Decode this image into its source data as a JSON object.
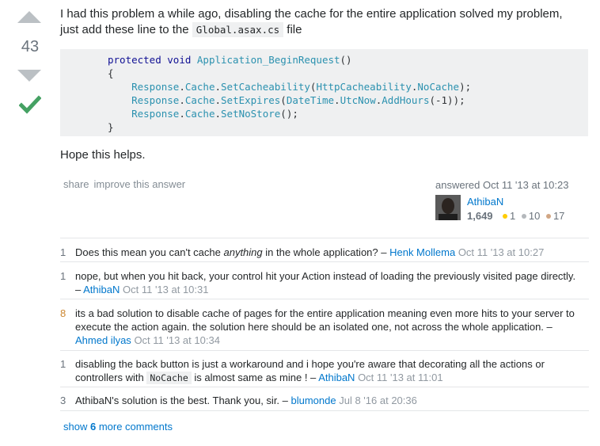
{
  "vote": {
    "count": "43"
  },
  "answer": {
    "text_before_code": "I had this problem a while ago, disabling the cache for the entire application solved my problem, just add these line to the ",
    "inline_code": "Global.asax.cs",
    "text_after_code": " file",
    "code": {
      "l1_kw": "protected",
      "l1_kw2": "void",
      "l1_fn": "Application_BeginRequest",
      "l1_rest": "()",
      "l2": "{",
      "l3_prefix": "    ",
      "l3_a": "Response",
      "l3_b": ".",
      "l3_c": "Cache",
      "l3_d": ".",
      "l3_e": "SetCacheability",
      "l3_f": "(",
      "l3_g": "HttpCacheability",
      "l3_h": ".",
      "l3_i": "NoCache",
      "l3_j": ");",
      "l4_a": "Response",
      "l4_c": "Cache",
      "l4_e": "SetExpires",
      "l4_g": "DateTime",
      "l4_i": "UtcNow",
      "l4_k": "AddHours",
      "l4_rest": "(-1));",
      "l5_a": "Response",
      "l5_c": "Cache",
      "l5_e": "SetNoStore",
      "l5_rest": "();",
      "l6": "}"
    },
    "closing": "Hope this helps."
  },
  "post_menu": {
    "share": "share",
    "improve": "improve this answer"
  },
  "user": {
    "action": "answered Oct 11 '13 at 10:23",
    "name": "AthibaN",
    "reputation": "1,649",
    "gold": "1",
    "silver": "10",
    "bronze": "17"
  },
  "comments": [
    {
      "score": "1",
      "pre": "Does this mean you can't cache ",
      "em": "anything",
      "post": " in the whole application? – ",
      "user": "Henk Mollema",
      "date": "Oct 11 '13 at 10:27"
    },
    {
      "score": "1",
      "text": "nope, but when you hit back, your control hit your Action instead of loading the previously visited page directly. – ",
      "user": "AthibaN",
      "date": "Oct 11 '13 at 10:31"
    },
    {
      "score": "8",
      "text": "its a bad solution to disable cache of pages for the entire application meaning even more hits to your server to execute the action again. the solution here should be an isolated one, not across the whole application. – ",
      "user": "Ahmed ilyas",
      "date": "Oct 11 '13 at 10:34"
    },
    {
      "score": "1",
      "pre": "disabling the back button is just a workaround and i hope you're aware that decorating all the actions or controllers with ",
      "code": "NoCache",
      "post": " is almost same as mine ! – ",
      "user": "AthibaN",
      "date": "Oct 11 '13 at 11:01"
    },
    {
      "score": "3",
      "text": "AthibaN's solution is the best. Thank you, sir. – ",
      "user": "blumonde",
      "date": "Jul 8 '16 at 20:36"
    }
  ],
  "show_more": {
    "pre": "show ",
    "count": "6",
    "post": " more comments"
  },
  "colors": {
    "link": "#0077cc",
    "accepted": "#45a163",
    "vote_arrow": "#bbc0c4"
  }
}
